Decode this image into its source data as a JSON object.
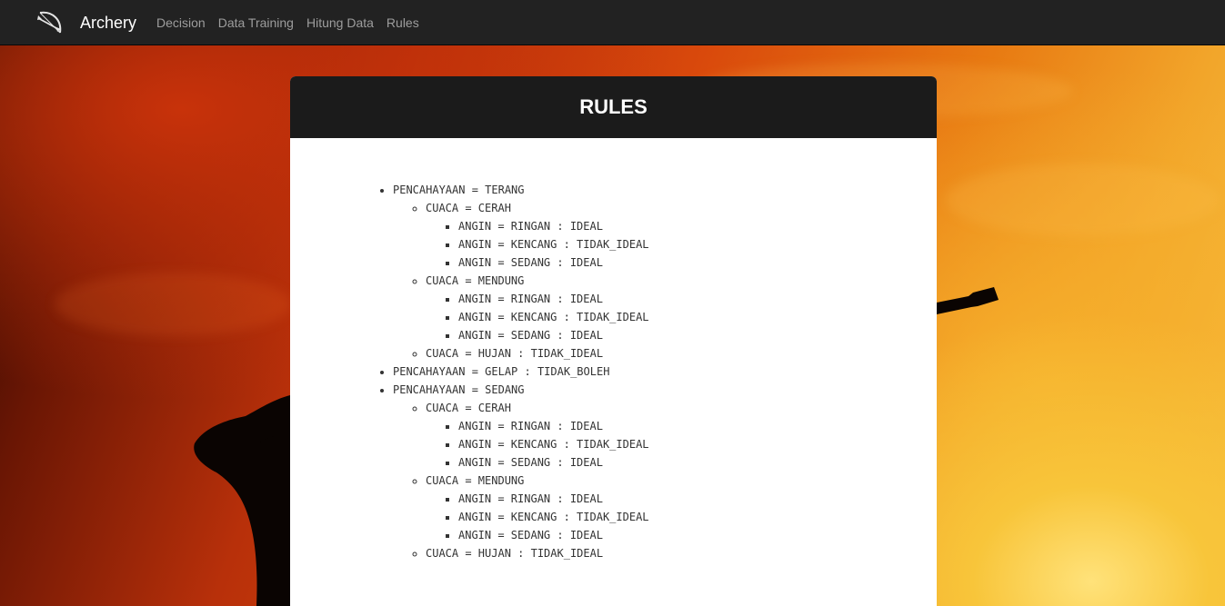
{
  "navbar": {
    "brand": "Archery",
    "links": [
      "Decision",
      "Data Training",
      "Hitung Data",
      "Rules"
    ]
  },
  "icons": {
    "brand": "bow-and-arrow-icon"
  },
  "colors": {
    "navbar_bg": "#222222",
    "panel_header_bg": "#1b1b1b",
    "nav_link": "#9d9d9d",
    "brand_text": "#ffffff"
  },
  "panel": {
    "title": "RULES"
  },
  "rules": [
    {
      "label": "PENCAHAYAAN = TERANG",
      "children": [
        {
          "label": "CUACA = CERAH",
          "children": [
            {
              "label": "ANGIN = RINGAN : IDEAL"
            },
            {
              "label": "ANGIN = KENCANG : TIDAK_IDEAL"
            },
            {
              "label": "ANGIN = SEDANG : IDEAL"
            }
          ]
        },
        {
          "label": "CUACA = MENDUNG",
          "children": [
            {
              "label": "ANGIN = RINGAN : IDEAL"
            },
            {
              "label": "ANGIN = KENCANG : TIDAK_IDEAL"
            },
            {
              "label": "ANGIN = SEDANG : IDEAL"
            }
          ]
        },
        {
          "label": "CUACA = HUJAN : TIDAK_IDEAL"
        }
      ]
    },
    {
      "label": "PENCAHAYAAN = GELAP : TIDAK_BOLEH"
    },
    {
      "label": "PENCAHAYAAN = SEDANG",
      "children": [
        {
          "label": "CUACA = CERAH",
          "children": [
            {
              "label": "ANGIN = RINGAN : IDEAL"
            },
            {
              "label": "ANGIN = KENCANG : TIDAK_IDEAL"
            },
            {
              "label": "ANGIN = SEDANG : IDEAL"
            }
          ]
        },
        {
          "label": "CUACA = MENDUNG",
          "children": [
            {
              "label": "ANGIN = RINGAN : IDEAL"
            },
            {
              "label": "ANGIN = KENCANG : TIDAK_IDEAL"
            },
            {
              "label": "ANGIN = SEDANG : IDEAL"
            }
          ]
        },
        {
          "label": "CUACA = HUJAN : TIDAK_IDEAL"
        }
      ]
    }
  ]
}
